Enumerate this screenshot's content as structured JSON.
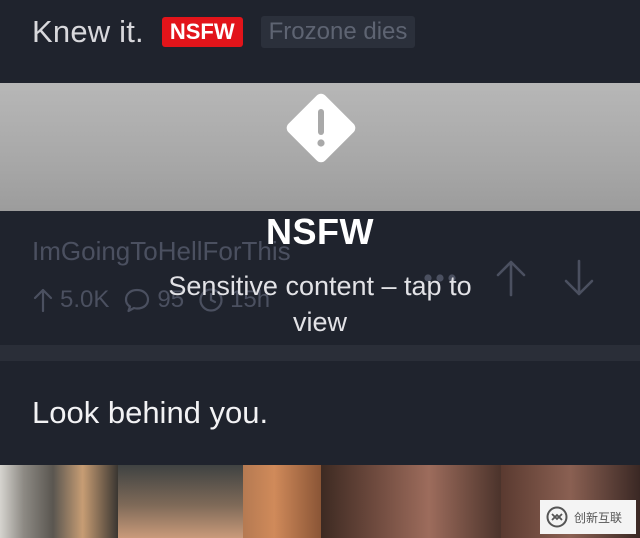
{
  "post1": {
    "title": "Knew it.",
    "nsfw_badge": "NSFW",
    "flair": "Frozone dies",
    "author": "ImGoingToHellForThis",
    "upvotes": "5.0K",
    "comments": "95",
    "age": "15h"
  },
  "overlay": {
    "title": "NSFW",
    "subtitle": "Sensitive content – tap to view"
  },
  "post2": {
    "title": "Look behind you."
  },
  "watermark": {
    "text": "创新互联"
  },
  "icons": {
    "warning": "warning-icon",
    "upvote": "arrow-up-icon",
    "comment": "comment-icon",
    "clock": "clock-icon",
    "more": "more-dots-icon",
    "vote_up": "arrow-up-icon",
    "vote_down": "arrow-down-icon"
  },
  "colors": {
    "background": "#1f232d",
    "nsfw_red": "#e2141a",
    "banner_grey": "#aaaaaa"
  }
}
